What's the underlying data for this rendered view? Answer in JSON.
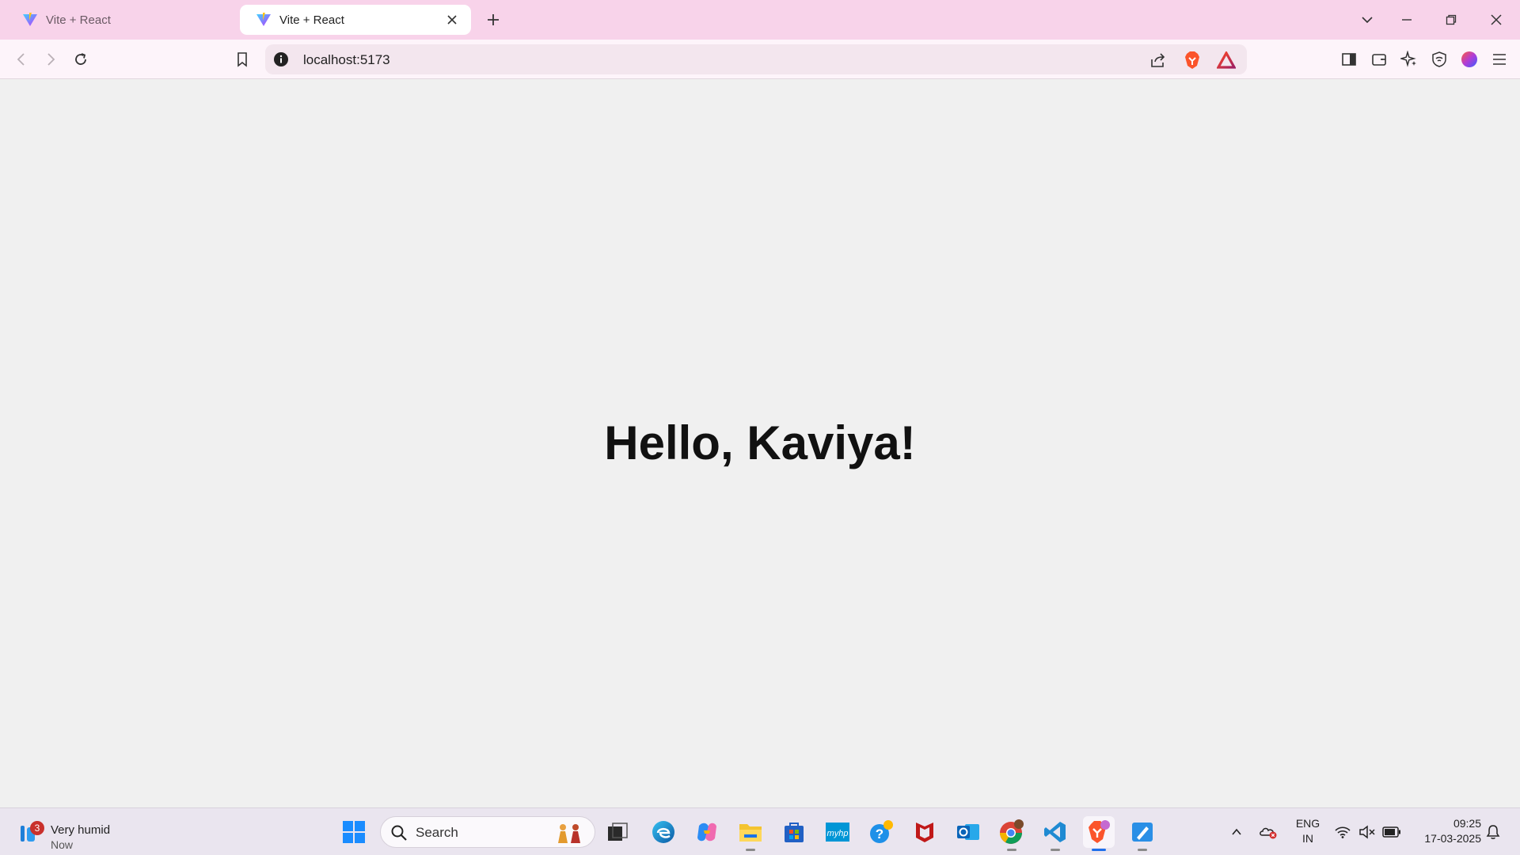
{
  "browser": {
    "tabs": [
      {
        "title": "Vite + React",
        "active": false
      },
      {
        "title": "Vite + React",
        "active": true
      }
    ],
    "address": "localhost:5173"
  },
  "page": {
    "heading": "Hello, Kaviya!"
  },
  "taskbar": {
    "weather": {
      "badge": "3",
      "condition": "Very humid",
      "time": "Now"
    },
    "search_placeholder": "Search",
    "language": {
      "line1": "ENG",
      "line2": "IN"
    },
    "clock": {
      "time": "09:25",
      "date": "17-03-2025"
    }
  },
  "colors": {
    "tabstrip": "#f8d3ea",
    "toolbar": "#fdf4fa",
    "page_bg": "#f0f0f0",
    "taskbar": "#eae5ef",
    "brave_orange": "#fb542b",
    "accent_blue": "#1f6feb"
  },
  "icons": [
    "vite-favicon",
    "close-icon",
    "plus-icon",
    "chevron-down-icon",
    "minimize-icon",
    "restore-icon",
    "back-icon",
    "forward-icon",
    "reload-icon",
    "bookmark-icon",
    "info-icon",
    "share-icon",
    "brave-shield-icon",
    "brave-rewards-icon",
    "sidebar-icon",
    "wallet-icon",
    "leo-ai-icon",
    "vpn-icon",
    "profile-icon",
    "menu-icon",
    "windows-start-icon",
    "search-icon"
  ]
}
